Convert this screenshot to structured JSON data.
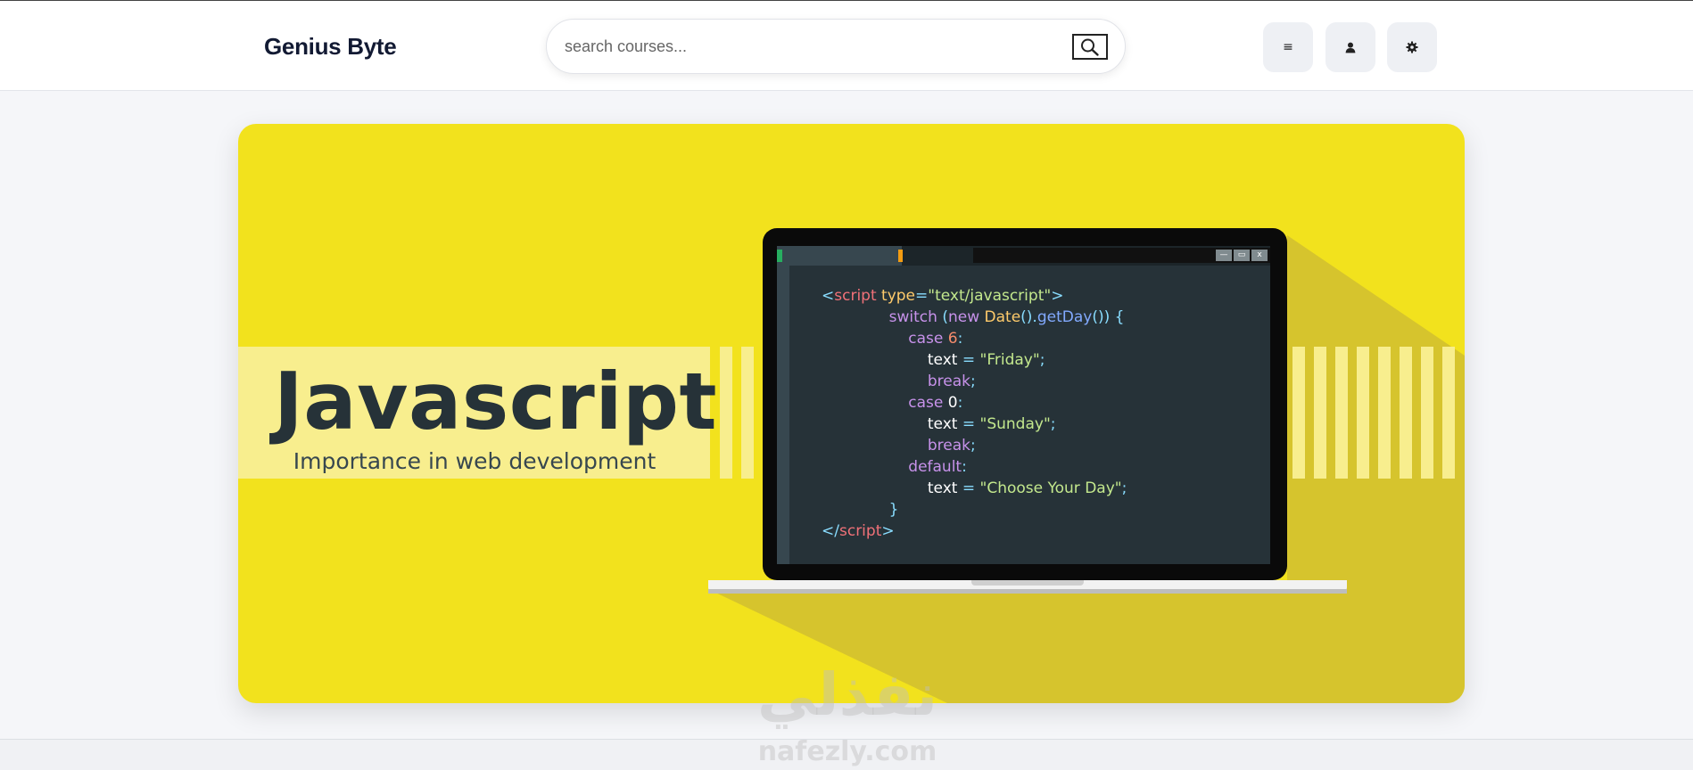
{
  "header": {
    "brand": "Genius Byte",
    "search": {
      "placeholder": "search courses..."
    },
    "buttons": {
      "menu": {
        "icon": "menu-icon",
        "glyph": "≡"
      },
      "user": {
        "icon": "user-icon",
        "glyph": "👤"
      },
      "settings": {
        "icon": "gear-icon",
        "glyph": "⚙"
      }
    }
  },
  "banner": {
    "title": "Javascript",
    "subtitle": "Importance in web development",
    "window_controls": [
      "—",
      "▭",
      "x"
    ],
    "code": [
      [
        [
          "c-punc",
          "<"
        ],
        [
          "c-tag",
          "script"
        ],
        [
          "",
          " "
        ],
        [
          "c-attr",
          "type"
        ],
        [
          "c-punc",
          "="
        ],
        [
          "c-str",
          "\"text/javascript\""
        ],
        [
          "c-punc",
          ">"
        ]
      ],
      [
        [
          "",
          "              "
        ],
        [
          "c-kw",
          "switch"
        ],
        [
          "",
          " "
        ],
        [
          "c-punc",
          "("
        ],
        [
          "c-kw",
          "new"
        ],
        [
          "",
          " "
        ],
        [
          "c-cls",
          "Date"
        ],
        [
          "c-punc",
          "()."
        ],
        [
          "c-fn",
          "getDay"
        ],
        [
          "c-punc",
          "()) {"
        ]
      ],
      [
        [
          "",
          "                  "
        ],
        [
          "c-kw",
          "case"
        ],
        [
          "",
          " "
        ],
        [
          "c-num",
          "6"
        ],
        [
          "c-punc",
          ":"
        ]
      ],
      [
        [
          "",
          "                      "
        ],
        [
          "",
          "text"
        ],
        [
          "",
          " "
        ],
        [
          "c-punc",
          "="
        ],
        [
          "",
          " "
        ],
        [
          "c-str",
          "\"Friday\""
        ],
        [
          "c-punc",
          ";"
        ]
      ],
      [
        [
          "",
          "                      "
        ],
        [
          "c-kw",
          "break"
        ],
        [
          "c-punc",
          ";"
        ]
      ],
      [
        [
          "",
          "                  "
        ],
        [
          "c-kw",
          "case"
        ],
        [
          "",
          " "
        ],
        [
          "",
          "0"
        ],
        [
          "c-punc",
          ":"
        ]
      ],
      [
        [
          "",
          "                      "
        ],
        [
          "",
          "text"
        ],
        [
          "",
          " "
        ],
        [
          "c-punc",
          "="
        ],
        [
          "",
          " "
        ],
        [
          "c-str",
          "\"Sunday\""
        ],
        [
          "c-punc",
          ";"
        ]
      ],
      [
        [
          "",
          "                      "
        ],
        [
          "c-kw",
          "break"
        ],
        [
          "c-punc",
          ";"
        ]
      ],
      [
        [
          "",
          "                  "
        ],
        [
          "c-kw",
          "default"
        ],
        [
          "c-punc",
          ":"
        ]
      ],
      [
        [
          "",
          "                      "
        ],
        [
          "",
          "text"
        ],
        [
          "",
          " "
        ],
        [
          "c-punc",
          "="
        ],
        [
          "",
          " "
        ],
        [
          "c-str",
          "\"Choose Your Day\""
        ],
        [
          "c-punc",
          ";"
        ]
      ],
      [
        [
          "",
          "              "
        ],
        [
          "c-punc",
          "}"
        ]
      ],
      [
        [
          "c-punc",
          "</"
        ],
        [
          "c-tag",
          "script"
        ],
        [
          "c-punc",
          ">"
        ]
      ]
    ]
  },
  "watermark": {
    "arabic": "نفذلي",
    "latin": "nafezly.com"
  }
}
